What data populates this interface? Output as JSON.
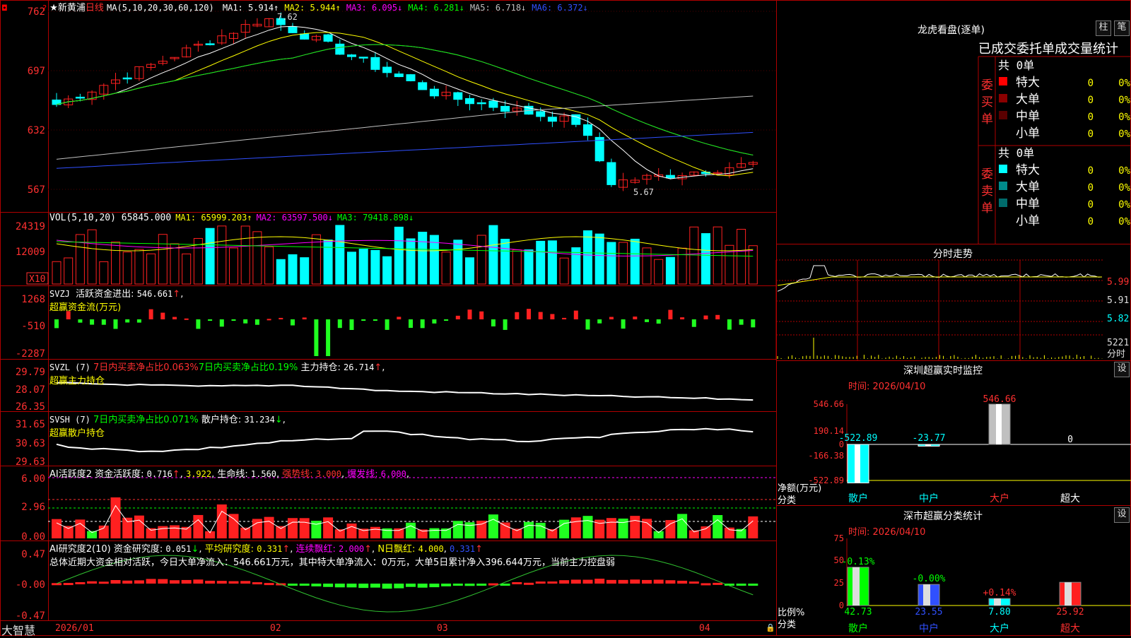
{
  "stock": {
    "star": "★",
    "name": "新黄浦",
    "period": "日线"
  },
  "price_panel": {
    "indicator": "MA(5,10,20,30,60,120)",
    "ma": [
      {
        "label": "MA1:",
        "value": "5.914",
        "arrow": "↑",
        "color": "#ffffff"
      },
      {
        "label": "MA2:",
        "value": "5.944",
        "arrow": "↑",
        "color": "#ffff00"
      },
      {
        "label": "MA3:",
        "value": "6.095",
        "arrow": "↓",
        "color": "#ff00ff"
      },
      {
        "label": "MA4:",
        "value": "6.281",
        "arrow": "↓",
        "color": "#00ff00"
      },
      {
        "label": "MA5:",
        "value": "6.718",
        "arrow": "↓",
        "color": "#c0c0c0"
      },
      {
        "label": "MA6:",
        "value": "6.372",
        "arrow": "↓",
        "color": "#3050ff"
      }
    ],
    "y_ticks": [
      "762",
      "697",
      "632",
      "567"
    ],
    "high_mark": "7.62",
    "low_mark": "5.67"
  },
  "vol_panel": {
    "title": "VOL(5,10,20)",
    "value": "65845.000",
    "ma": [
      {
        "label": "MA1:",
        "value": "65999.203",
        "arrow": "↑",
        "color": "#ffff00"
      },
      {
        "label": "MA2:",
        "value": "63597.500",
        "arrow": "↓",
        "color": "#ff00ff"
      },
      {
        "label": "MA3:",
        "value": "79418.898",
        "arrow": "↓",
        "color": "#00ff00"
      }
    ],
    "y_ticks": [
      "24319",
      "12009"
    ],
    "unit": "X10"
  },
  "svzj_panel": {
    "name": "SVZJ",
    "label": "活跃资金进出:",
    "value": "546.661",
    "arrow": "↑",
    "sub": "超赢资金流(万元)",
    "y_ticks": [
      "1268",
      "-510",
      "-2287"
    ]
  },
  "svzl_panel": {
    "name": "SVZL (7)",
    "t1": "7日内买卖净占比0.063%",
    "t2": "7日内买卖净占比0.19%",
    "label": "主力持仓:",
    "value": "26.714",
    "arrow": "↑",
    "sub": "超赢主力持仓",
    "y_ticks": [
      "29.79",
      "28.07",
      "26.35"
    ]
  },
  "svsh_panel": {
    "name": "SVSH (7)",
    "t1": "7日内买卖净占比0.071%",
    "label": "散户持仓:",
    "value": "31.234",
    "arrow": "↓",
    "sub": "超赢散户持仓",
    "y_ticks": [
      "31.65",
      "30.63",
      "29.63"
    ]
  },
  "ai_active": {
    "name": "AI活跃度2",
    "l1": "资金活跃度:",
    "v1": "0.716",
    "a1": "↑",
    "v2": "3.922",
    "l3": "生命线:",
    "v3": "1.560",
    "l4": "强势线:",
    "v4": "3.000",
    "l5": "爆发线:",
    "v5": "6.000",
    "y_ticks": [
      "6.00",
      "2.96",
      "0.00"
    ]
  },
  "ai_research": {
    "name": "AI研究度2(10)",
    "l1": "资金研究度:",
    "v1": "0.051",
    "a1": "↓",
    "l2": "平均研究度:",
    "v2": "0.331",
    "a2": "↑",
    "l3": "连续飘红:",
    "v3": "2.000",
    "a3": "↑",
    "l4": "N日飘红:",
    "v4": "4.000",
    "v5": "0.331",
    "a5": "↑",
    "comment": "总体近期大资金相对活跃，今日大单净流入：546.661万元，其中特大单净流入：0万元，大单5日累计净入396.644万元，当前主力控盘弱",
    "y_ticks": [
      "0.47",
      "-0.00",
      "-0.47"
    ]
  },
  "x_axis": {
    "brand": "大智慧",
    "dates": [
      "2026/01",
      "02",
      "03",
      "04"
    ]
  },
  "dragon": {
    "title": "龙虎看盘(逐单)",
    "btn_zhu": "柱",
    "btn_bi": "笔",
    "header": "已成交委托单成交量统计",
    "buy_label": "委买单",
    "sell_label": "委卖单",
    "buy_total": "共 0单",
    "sell_total": "共 0单",
    "buy_rows": [
      {
        "name": "特大",
        "count": "0",
        "pct": "0%",
        "color": "#ff0000"
      },
      {
        "name": "大单",
        "count": "0",
        "pct": "0%",
        "color": "#8b0000"
      },
      {
        "name": "中单",
        "count": "0",
        "pct": "0%",
        "color": "#5a0000"
      },
      {
        "name": "小单",
        "count": "0",
        "pct": "0%",
        "color": ""
      }
    ],
    "sell_rows": [
      {
        "name": "特大",
        "count": "0",
        "pct": "0%",
        "color": "#00ffff"
      },
      {
        "name": "大单",
        "count": "0",
        "pct": "0%",
        "color": "#008b8b"
      },
      {
        "name": "中单",
        "count": "0",
        "pct": "0%",
        "color": "#006b6b"
      },
      {
        "name": "小单",
        "count": "0",
        "pct": "0%",
        "color": ""
      }
    ]
  },
  "intraday": {
    "title": "分时走势",
    "y_ticks": [
      "5.99",
      "5.91",
      "5.82"
    ],
    "vol_label": "5221",
    "vol_sub": "分时"
  },
  "sz_monitor": {
    "title": "深圳超赢实时监控",
    "set_btn": "设",
    "time_label": "时间: 2026/04/10",
    "y_ticks": [
      "546.66",
      "190.14",
      "0",
      "-166.38",
      "-522.89"
    ],
    "side_label1": "净额(万元)",
    "side_label2": "分类",
    "categories": [
      "散户",
      "中户",
      "大户",
      "超大"
    ],
    "values": [
      -522.89,
      -23.77,
      546.66,
      0
    ],
    "value_labels": [
      "-522.89",
      "-23.77",
      "546.66",
      "0"
    ]
  },
  "sz_class": {
    "title": "深市超赢分类统计",
    "set_btn": "设",
    "time_label": "时间: 2026/04/10",
    "y_ticks": [
      "75",
      "50",
      "25",
      "0"
    ],
    "side_label1": "比例%",
    "side_label2": "分类",
    "categories": [
      "散户",
      "中户",
      "大户",
      "超大"
    ],
    "values": [
      42.73,
      23.55,
      7.8,
      25.92
    ],
    "value_labels": [
      "42.73",
      "23.55",
      "7.80",
      "25.92"
    ],
    "change_labels": [
      "-0.13%",
      "-0.00%",
      "+0.14%",
      ""
    ]
  },
  "colors": {
    "up": "#ff2020",
    "down": "#00ffff",
    "grid": "#c00000",
    "axis_text": "#ff3030"
  }
}
